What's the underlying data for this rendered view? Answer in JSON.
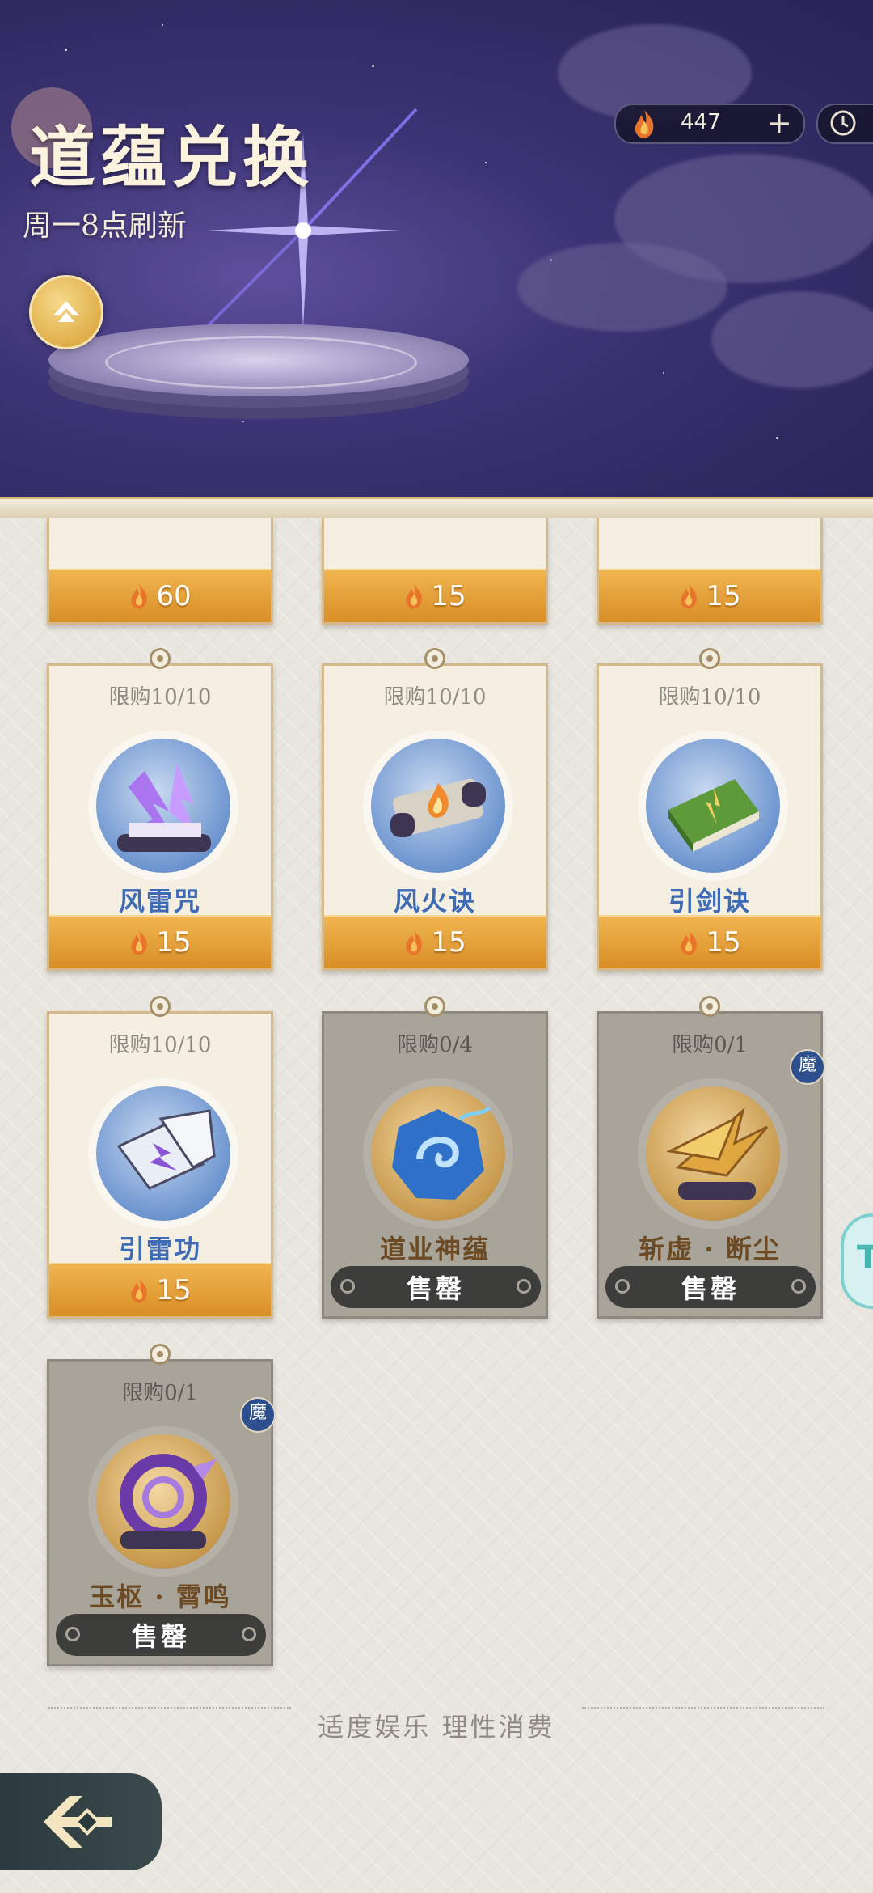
{
  "header": {
    "title": "道蕴兑换",
    "refresh_note": "周一8点刷新",
    "currency_amount": "447",
    "currency_plus": "+"
  },
  "top_row": [
    {
      "price": "60"
    },
    {
      "price": "15"
    },
    {
      "price": "15"
    }
  ],
  "items": [
    {
      "limit": "限购10/10",
      "name": "风雷咒",
      "price": "15",
      "status": "available"
    },
    {
      "limit": "限购10/10",
      "name": "风火诀",
      "price": "15",
      "status": "available"
    },
    {
      "limit": "限购10/10",
      "name": "引剑诀",
      "price": "15",
      "status": "available"
    },
    {
      "limit": "限购10/10",
      "name": "引雷功",
      "price": "15",
      "status": "available"
    },
    {
      "limit": "限购0/4",
      "name": "道业神蕴",
      "sold_label": "售罄",
      "status": "soldout"
    },
    {
      "limit": "限购0/1",
      "name": "斩虚 · 断尘",
      "sold_label": "售罄",
      "badge": "魔",
      "status": "soldout"
    },
    {
      "limit": "限购0/1",
      "name": "玉枢 · 霄鸣",
      "sold_label": "售罄",
      "badge": "魔",
      "status": "soldout"
    }
  ],
  "footer": {
    "note": "适度娱乐 理性消费"
  },
  "side_chip": {
    "label": "T"
  },
  "icons": {
    "currency": "flame-icon",
    "clock": "clock-icon",
    "up": "chevron-up-icon",
    "back": "back-icon"
  },
  "colors": {
    "accent": "#d98e27",
    "item_name": "#3f6bb6",
    "sold_name": "#6c4a23"
  }
}
